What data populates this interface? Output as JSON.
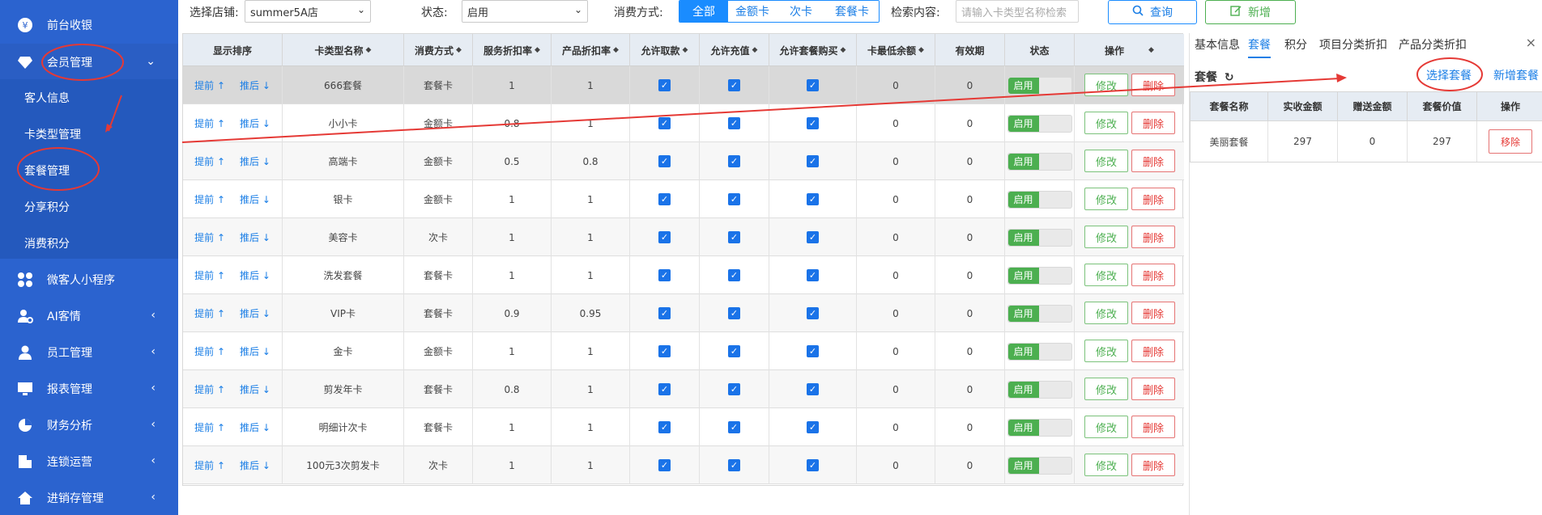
{
  "sidebar": {
    "top_item": "前台收银",
    "member": "会员管理",
    "sub_items": [
      "客人信息",
      "卡类型管理",
      "套餐管理",
      "分享积分",
      "消费积分"
    ],
    "items": [
      "微客人小程序",
      "AI客情",
      "员工管理",
      "报表管理",
      "财务分析",
      "连锁运营",
      "进销存管理"
    ]
  },
  "filters": {
    "store_label": "选择店铺:",
    "store_value": "summer5A店",
    "status_label": "状态:",
    "status_value": "启用",
    "pay_label": "消费方式:",
    "pay_options": [
      "全部",
      "金额卡",
      "次卡",
      "套餐卡"
    ],
    "search_label": "检索内容:",
    "search_placeholder": "请输入卡类型名称检索",
    "query_button": "查询",
    "add_button": "新增"
  },
  "table": {
    "headers": [
      "显示排序",
      "卡类型名称",
      "消费方式",
      "服务折扣率",
      "产品折扣率",
      "允许取款",
      "允许充值",
      "允许套餐购买",
      "卡最低余额",
      "有效期",
      "状态",
      "操作"
    ],
    "move_up": "提前",
    "move_down": "推后",
    "status_on": "启用",
    "edit_label": "修改",
    "delete_label": "删除",
    "rows": [
      {
        "name": "666套餐",
        "type": "套餐卡",
        "svc": "1",
        "prd": "1",
        "min": "0",
        "exp": "0"
      },
      {
        "name": "小小卡",
        "type": "金额卡",
        "svc": "0.8",
        "prd": "1",
        "min": "0",
        "exp": "0"
      },
      {
        "name": "高端卡",
        "type": "金额卡",
        "svc": "0.5",
        "prd": "0.8",
        "min": "0",
        "exp": "0"
      },
      {
        "name": "银卡",
        "type": "金额卡",
        "svc": "1",
        "prd": "1",
        "min": "0",
        "exp": "0"
      },
      {
        "name": "美容卡",
        "type": "次卡",
        "svc": "1",
        "prd": "1",
        "min": "0",
        "exp": "0"
      },
      {
        "name": "洗发套餐",
        "type": "套餐卡",
        "svc": "1",
        "prd": "1",
        "min": "0",
        "exp": "0"
      },
      {
        "name": "VIP卡",
        "type": "套餐卡",
        "svc": "0.9",
        "prd": "0.95",
        "min": "0",
        "exp": "0"
      },
      {
        "name": "金卡",
        "type": "金额卡",
        "svc": "1",
        "prd": "1",
        "min": "0",
        "exp": "0"
      },
      {
        "name": "剪发年卡",
        "type": "套餐卡",
        "svc": "0.8",
        "prd": "1",
        "min": "0",
        "exp": "0"
      },
      {
        "name": "明细计次卡",
        "type": "套餐卡",
        "svc": "1",
        "prd": "1",
        "min": "0",
        "exp": "0"
      },
      {
        "name": "100元3次剪发卡",
        "type": "次卡",
        "svc": "1",
        "prd": "1",
        "min": "0",
        "exp": "0"
      }
    ]
  },
  "panel": {
    "tabs": [
      "基本信息",
      "套餐",
      "积分",
      "项目分类折扣",
      "产品分类折扣"
    ],
    "close": "×",
    "title": "套餐",
    "refresh_icon": "↻",
    "select_link": "选择套餐",
    "new_link": "新增套餐",
    "headers": [
      "套餐名称",
      "实收金额",
      "赠送金额",
      "套餐价值",
      "操作"
    ],
    "row": {
      "name": "美丽套餐",
      "paid": "297",
      "gift": "0",
      "value": "297",
      "action": "移除"
    }
  },
  "colors": {
    "sidebar": "#2b63cf",
    "accent": "#1a8cff",
    "annotation": "#e53935"
  }
}
